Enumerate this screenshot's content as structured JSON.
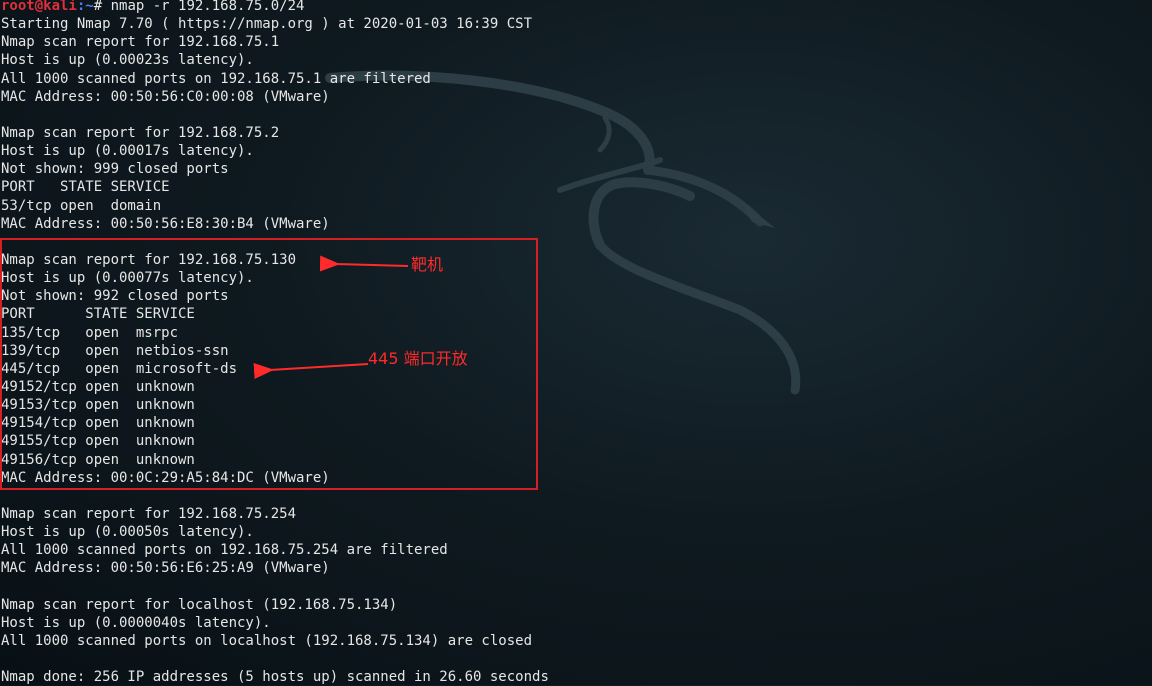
{
  "terminal": {
    "prompt_user_host": "root@kali",
    "prompt_path": ":~",
    "prompt_symbol": "#",
    "command": "nmap -r 192.168.75.0/24",
    "lines": [
      "Starting Nmap 7.70 ( https://nmap.org ) at 2020-01-03 16:39 CST",
      "Nmap scan report for 192.168.75.1",
      "Host is up (0.00023s latency).",
      "All 1000 scanned ports on 192.168.75.1 are filtered",
      "MAC Address: 00:50:56:C0:00:08 (VMware)",
      "",
      "Nmap scan report for 192.168.75.2",
      "Host is up (0.00017s latency).",
      "Not shown: 999 closed ports",
      "PORT   STATE SERVICE",
      "53/tcp open  domain",
      "MAC Address: 00:50:56:E8:30:B4 (VMware)",
      "",
      "Nmap scan report for 192.168.75.130",
      "Host is up (0.00077s latency).",
      "Not shown: 992 closed ports",
      "PORT      STATE SERVICE",
      "135/tcp   open  msrpc",
      "139/tcp   open  netbios-ssn",
      "445/tcp   open  microsoft-ds",
      "49152/tcp open  unknown",
      "49153/tcp open  unknown",
      "49154/tcp open  unknown",
      "49155/tcp open  unknown",
      "49156/tcp open  unknown",
      "MAC Address: 00:0C:29:A5:84:DC (VMware)",
      "",
      "Nmap scan report for 192.168.75.254",
      "Host is up (0.00050s latency).",
      "All 1000 scanned ports on 192.168.75.254 are filtered",
      "MAC Address: 00:50:56:E6:25:A9 (VMware)",
      "",
      "Nmap scan report for localhost (192.168.75.134)",
      "Host is up (0.0000040s latency).",
      "All 1000 scanned ports on localhost (192.168.75.134) are closed",
      "",
      "Nmap done: 256 IP addresses (5 hosts up) scanned in 26.60 seconds"
    ]
  },
  "annotations": {
    "target_label": "靶机",
    "port_label": "445 端口开放"
  },
  "colors": {
    "prompt_user": "#e0303a",
    "prompt_path": "#4d7cf0",
    "annotation": "#ff2a2a",
    "highlight_border": "#d41f24"
  },
  "background_logo": "kali-dragon-icon"
}
